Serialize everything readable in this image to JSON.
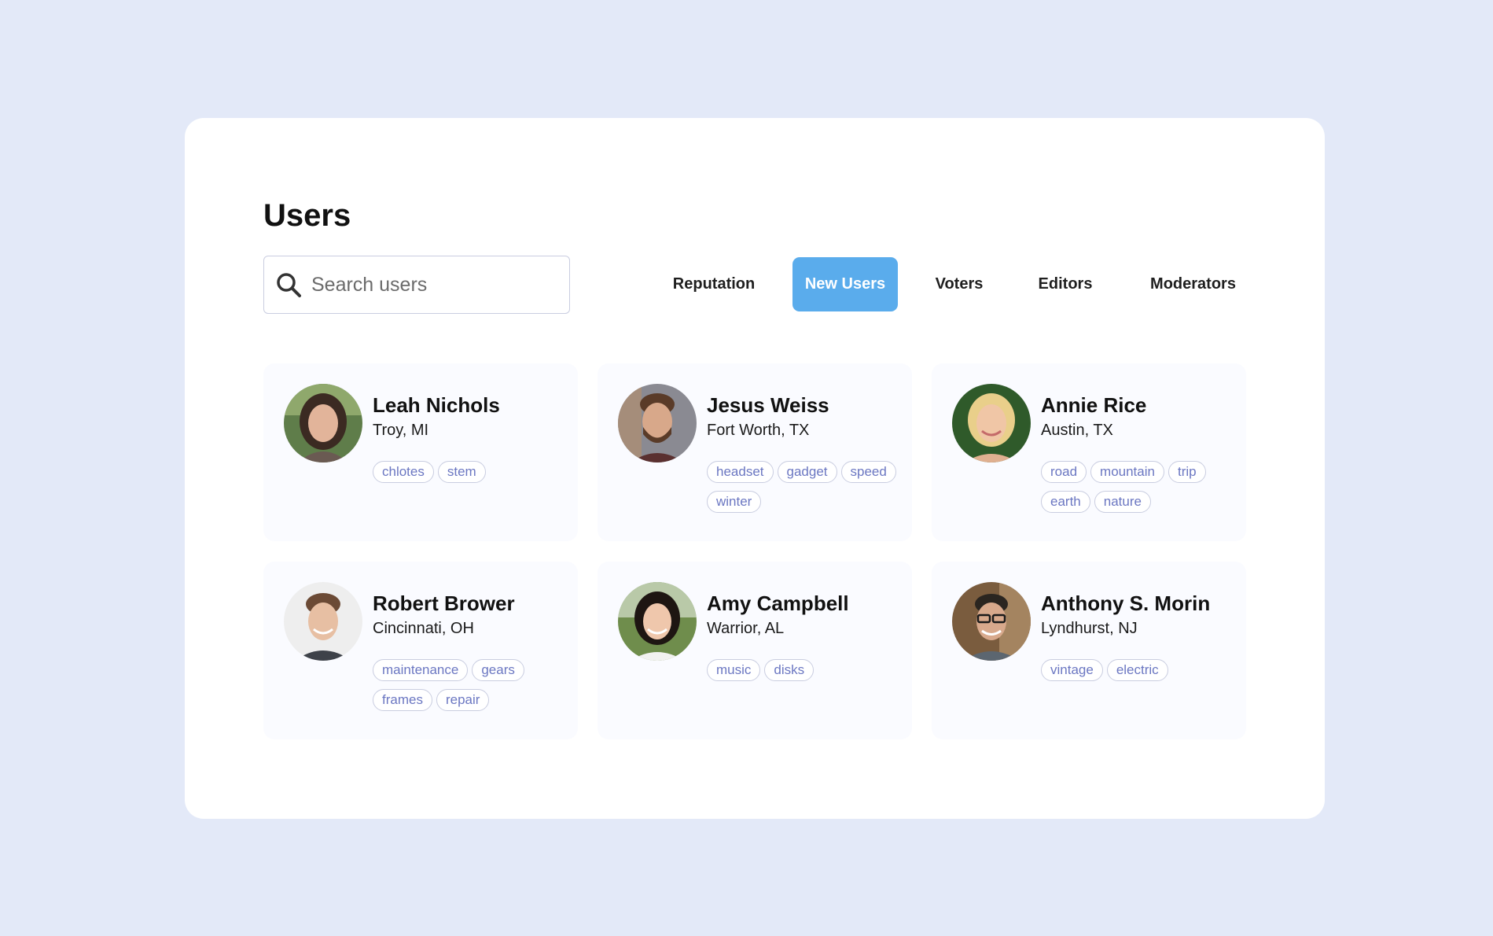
{
  "page": {
    "title": "Users"
  },
  "search": {
    "placeholder": "Search users"
  },
  "tabs": [
    {
      "label": "Reputation",
      "active": false
    },
    {
      "label": "New Users",
      "active": true
    },
    {
      "label": "Voters",
      "active": false
    },
    {
      "label": "Editors",
      "active": false
    },
    {
      "label": "Moderators",
      "active": false
    }
  ],
  "users": [
    {
      "name": "Leah Nichols",
      "location": "Troy, MI",
      "tags": [
        "chlotes",
        "stem"
      ]
    },
    {
      "name": "Jesus Weiss",
      "location": "Fort Worth, TX",
      "tags": [
        "headset",
        "gadget",
        "speed",
        "winter"
      ]
    },
    {
      "name": "Annie Rice",
      "location": "Austin, TX",
      "tags": [
        "road",
        "mountain",
        "trip",
        "earth",
        "nature"
      ]
    },
    {
      "name": "Robert Brower",
      "location": "Cincinnati, OH",
      "tags": [
        "maintenance",
        "gears",
        "frames",
        "repair"
      ]
    },
    {
      "name": "Amy Campbell",
      "location": "Warrior, AL",
      "tags": [
        "music",
        "disks"
      ]
    },
    {
      "name": "Anthony S. Morin",
      "location": "Lyndhurst, NJ",
      "tags": [
        "vintage",
        "electric"
      ]
    }
  ],
  "colors": {
    "background": "#e3e9f8",
    "panel": "#ffffff",
    "active_tab": "#5aacec",
    "tag_text": "#6b77c2",
    "tag_border": "#c9cde0"
  },
  "icons": {
    "search": "search-icon"
  }
}
